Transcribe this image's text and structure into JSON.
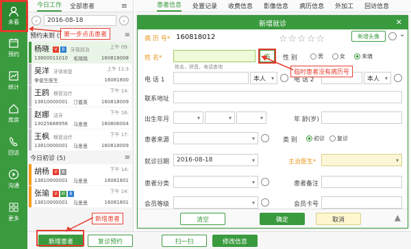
{
  "nav": {
    "top_label": "未看",
    "items": [
      {
        "label": "预约",
        "icon": "calendar-icon"
      },
      {
        "label": "统计",
        "icon": "chart-icon"
      },
      {
        "label": "库房",
        "icon": "home-icon"
      },
      {
        "label": "回访",
        "icon": "phone-icon"
      },
      {
        "label": "沟通",
        "icon": "play-icon"
      },
      {
        "label": "更多",
        "icon": "grid-icon"
      }
    ]
  },
  "list": {
    "tabs": [
      "今日工作",
      "全部患者"
    ],
    "date": "2016-08-18",
    "section1": "预约未到 (5)",
    "section2": "今日初诊 (5)",
    "patients": [
      {
        "name": "杨晓",
        "note": "牙周刮治",
        "time": "上午 09:",
        "phone": "13800011010",
        "doctor": "毛晓晓",
        "id": "160818008"
      },
      {
        "name": "吴洋",
        "note": "牙体修复",
        "time": "上午 11:3",
        "phone": "李俊生医生",
        "doctor": "",
        "id": "16081800"
      },
      {
        "name": "王鸥",
        "note": "根管治疗",
        "time": "下午 14:",
        "phone": "13810000001",
        "doctor": "汀春英",
        "id": "160818009"
      },
      {
        "name": "赵娜",
        "note": "洁牙",
        "time": "下午 16:",
        "phone": "13025688956",
        "doctor": "马思思",
        "id": "160806004"
      },
      {
        "name": "王枫",
        "note": "根管治疗",
        "time": "下午 17:",
        "phone": "13810000001",
        "doctor": "马思思",
        "id": "160818009"
      },
      {
        "name": "胡杨",
        "note": "",
        "time": "下午 14:",
        "phone": "13810000001",
        "doctor": "马思思",
        "id": "16081801"
      },
      {
        "name": "张瑜",
        "note": "",
        "time": "下午 14:",
        "phone": "13810000001",
        "doctor": "马思思",
        "id": "16081801"
      }
    ],
    "annot_step1": "第一步点击患者",
    "annot_new": "新增患者"
  },
  "bottom": {
    "new_patient": "新增患者",
    "rebook": "复诊预约",
    "scan": "扫一扫",
    "edit": "修改信息"
  },
  "right_tabs": [
    "患者信息",
    "处置记录",
    "收费信息",
    "影像信息",
    "病历信息",
    "外加工",
    "回访信息"
  ],
  "dialog": {
    "title": "新增就诊",
    "record_label": "病 历 号*",
    "record_value": "160818012",
    "new_avatar": "新增头像",
    "name_label": "姓    名*",
    "name_value": "",
    "name_btn": "临",
    "name_hint": "姓名，拼音，电话查询",
    "gender_label": "性    别",
    "gender_opts": [
      "男",
      "女",
      "未填"
    ],
    "annot_temp": "临时患者没有病历号",
    "phone1_label": "电 话 1",
    "phone1_owner": "本人",
    "phone2_label": "电 话 2",
    "phone2_owner": "本人",
    "address_label": "联系地址",
    "birth_label": "出生年月",
    "age_label": "年 龄(岁)",
    "source_label": "患者来源",
    "type_label": "类    别",
    "type_opts": [
      "初诊",
      "复诊"
    ],
    "date_label": "就诊日期",
    "date_value": "2016-08-18",
    "doctor_label": "主治医生*",
    "category_label": "患者分类",
    "remark_label": "患者备注",
    "level_label": "会员等级",
    "card_label": "会员卡号",
    "clear": "清空",
    "ok": "确定",
    "cancel": "取消"
  },
  "colors": {
    "brand": "#3a9a3e",
    "alert": "#e53b2e",
    "warn": "#f39c1a"
  }
}
